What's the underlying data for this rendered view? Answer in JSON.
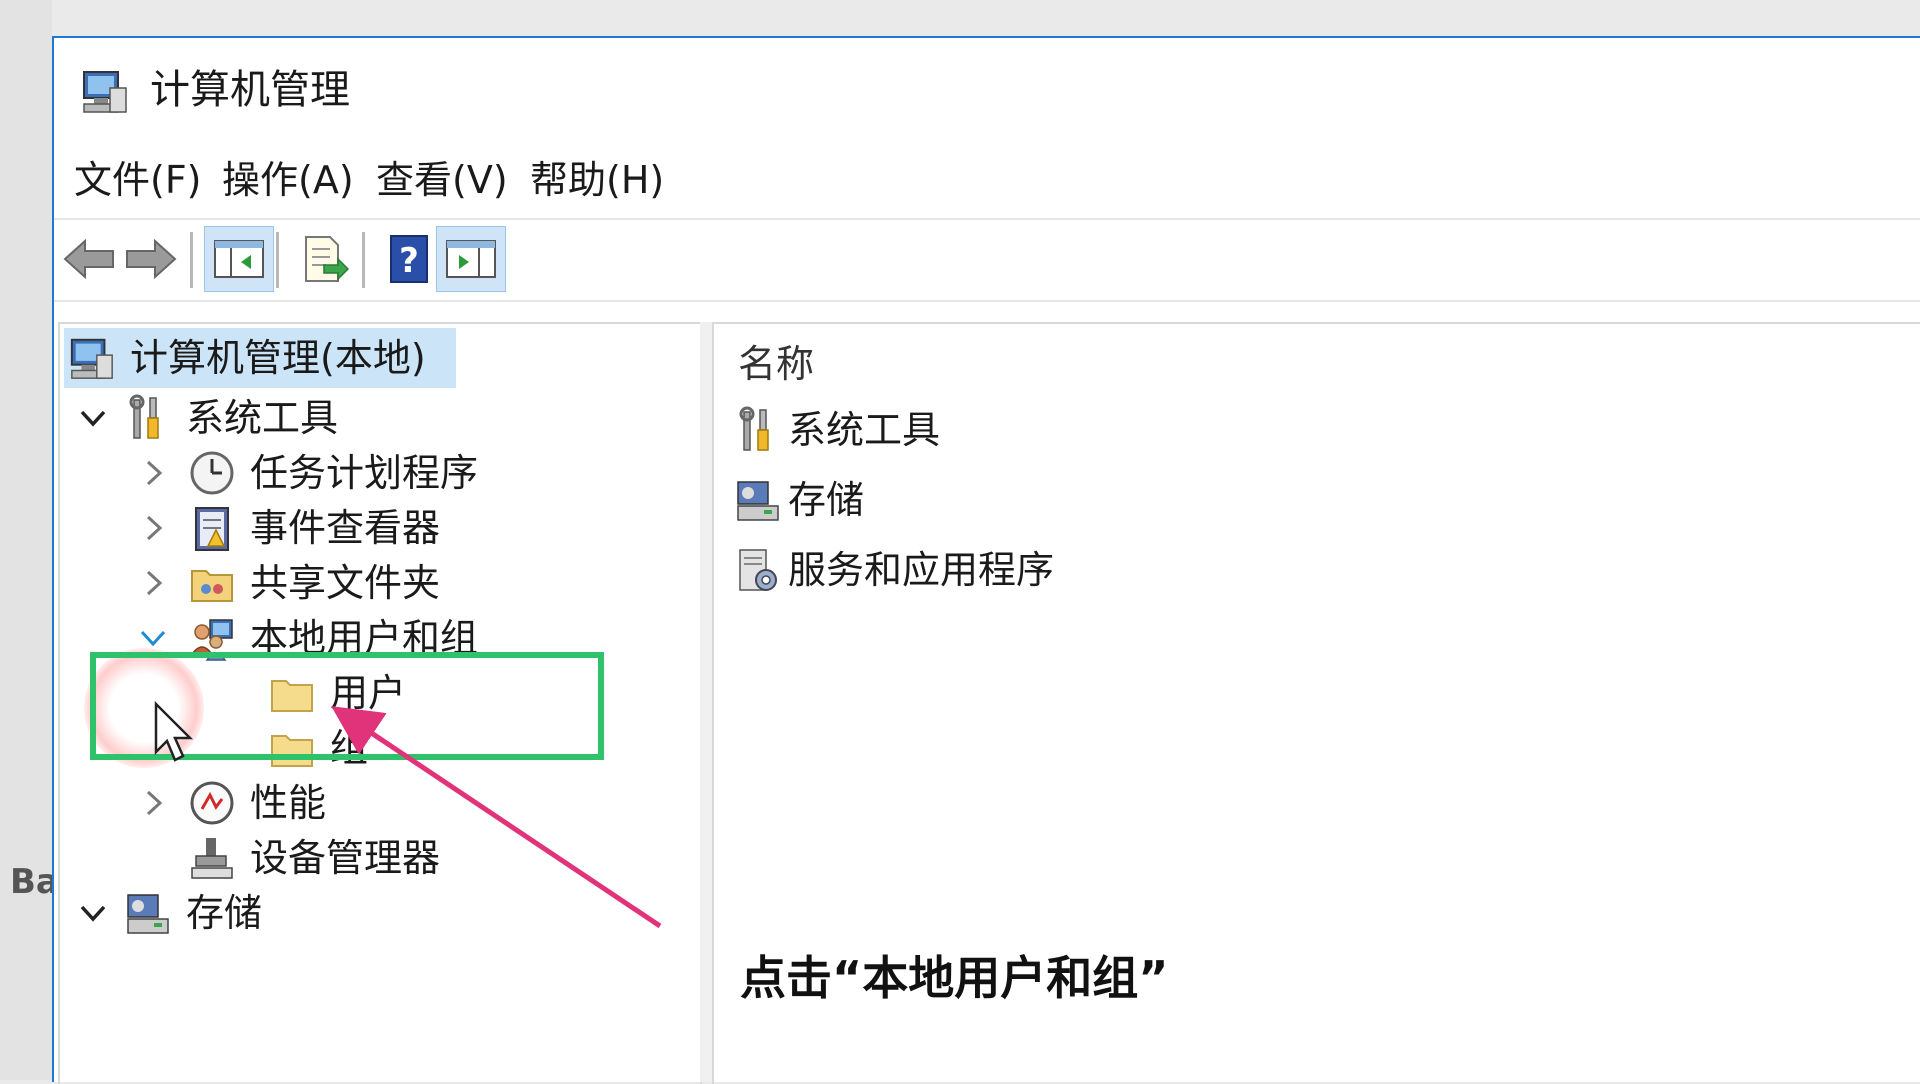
{
  "window": {
    "title": "计算机管理"
  },
  "menu": [
    "文件(F)",
    "操作(A)",
    "查看(V)",
    "帮助(H)"
  ],
  "toolbar": [
    "back-icon",
    "forward-icon",
    "show-tree-icon",
    "export-icon",
    "help-icon",
    "show-action-pane-icon"
  ],
  "tree": {
    "root": "计算机管理(本地)",
    "system_tools": "系统工具",
    "task_scheduler": "任务计划程序",
    "event_viewer": "事件查看器",
    "shared_folders": "共享文件夹",
    "local_users_groups": "本地用户和组",
    "users": "用户",
    "groups": "组",
    "performance": "性能",
    "device_manager": "设备管理器",
    "storage": "存储"
  },
  "list": {
    "header": "名称",
    "items": [
      "系统工具",
      "存储",
      "服务和应用程序"
    ]
  },
  "caption": "点击“本地用户和组”",
  "desktop_text": "Ba",
  "colors": {
    "accent": "#1f78d1",
    "highlight_box": "#2ec36b",
    "arrow": "#e0337a",
    "selection": "#cce4f7"
  }
}
